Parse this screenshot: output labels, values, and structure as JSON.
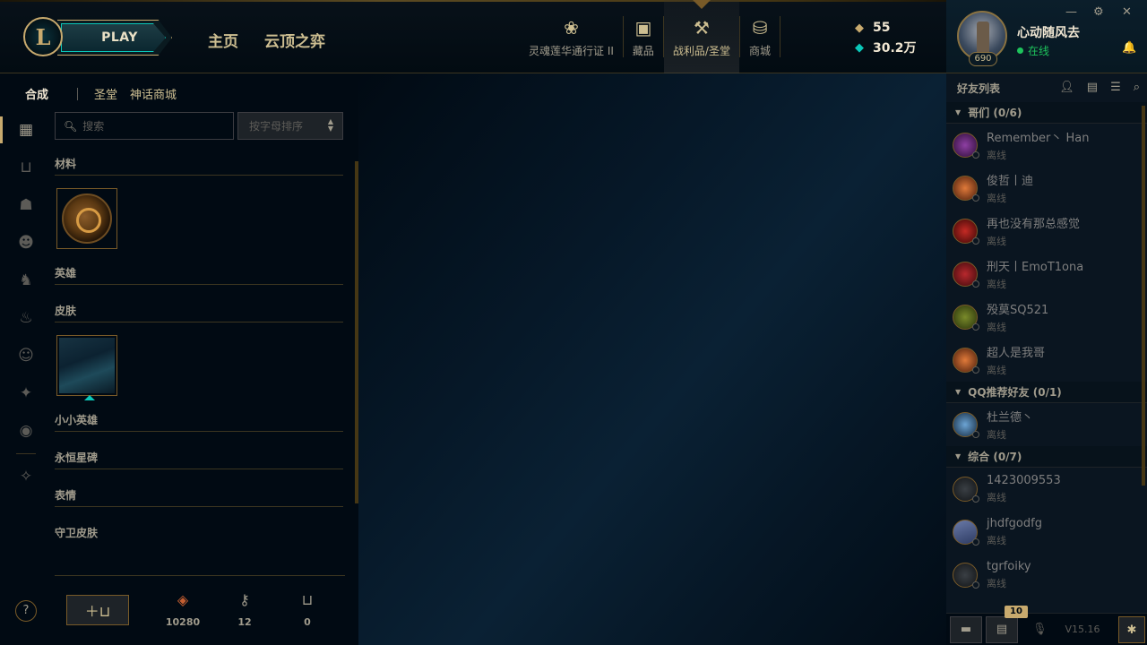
{
  "header": {
    "play_label": "PLAY",
    "nav_home": "主页",
    "nav_tft": "云顶之弈",
    "nav_icons": [
      {
        "label": "灵魂莲华通行证 II",
        "icon": "lotus-icon"
      },
      {
        "label": "藏品",
        "icon": "briefcase-icon"
      },
      {
        "label": "战利品/圣堂",
        "icon": "hammer-icon",
        "active": true
      },
      {
        "label": "商城",
        "icon": "coins-icon"
      }
    ],
    "rp_value": "55",
    "be_value": "30.2万"
  },
  "profile": {
    "name": "心动随风去",
    "status": "在线",
    "level": "690"
  },
  "loot": {
    "tabs": [
      "合成",
      "圣堂",
      "神话商城"
    ],
    "search_placeholder": "搜索",
    "sort_label": "按字母排序",
    "categories": {
      "materials": "材料",
      "champions": "英雄",
      "skins": "皮肤",
      "little_legends": "小小英雄",
      "eternals": "永恒星碑",
      "emotes": "表情",
      "ward_skins": "守卫皮肤"
    },
    "resources": {
      "orange_essence": "10280",
      "keys": "12",
      "chests": "0"
    }
  },
  "friends": {
    "title": "好友列表",
    "groups": [
      {
        "name": "哥们 (0/6)",
        "members": [
          {
            "name": "Remember丶 Han",
            "status": "离线"
          },
          {
            "name": "俊哲丨迪",
            "status": "离线"
          },
          {
            "name": "再也没有那总感觉",
            "status": "离线"
          },
          {
            "name": "刑天丨EmoT1ona",
            "status": "离线"
          },
          {
            "name": "殁莫SQ521",
            "status": "离线"
          },
          {
            "name": "超人是我哥",
            "status": "离线"
          }
        ]
      },
      {
        "name": "QQ推荐好友 (0/1)",
        "members": [
          {
            "name": "杜兰德丶",
            "status": "离线"
          }
        ]
      },
      {
        "name": "综合 (0/7)",
        "members": [
          {
            "name": "1423009553",
            "status": "离线"
          },
          {
            "name": "jhdfgodfg",
            "status": "离线"
          },
          {
            "name": "tgrfoiky",
            "status": "离线"
          }
        ]
      }
    ],
    "notification_count": "10",
    "version": "V15.16"
  }
}
